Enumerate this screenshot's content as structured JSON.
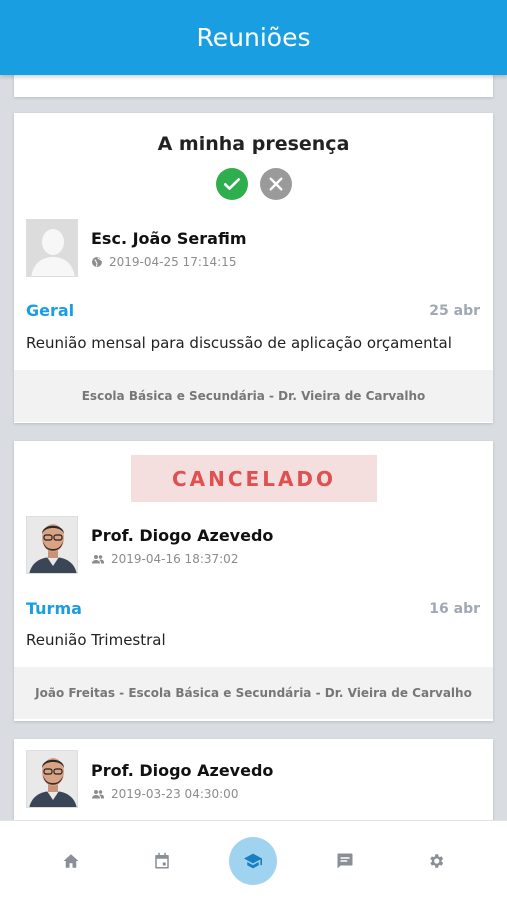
{
  "header": {
    "title": "Reuniões"
  },
  "cards": [
    {
      "presence_title": "A minha presença",
      "author": "Esc. João Serafim",
      "timestamp": "2019-04-25 17:14:15",
      "visibility_icon": "globe-icon",
      "category": "Geral",
      "date": "25 abr",
      "description": "Reunião mensal para discussão de aplicação orçamental",
      "footer": "Escola Básica e Secundária - Dr. Vieira de Carvalho"
    },
    {
      "status_badge": "CANCELADO",
      "author": "Prof. Diogo Azevedo",
      "timestamp": "2019-04-16 18:37:02",
      "visibility_icon": "group-icon",
      "category": "Turma",
      "date": "16 abr",
      "description": "Reunião Trimestral",
      "footer": "João Freitas - Escola Básica e Secundária - Dr. Vieira de Carvalho"
    },
    {
      "author": "Prof. Diogo Azevedo",
      "timestamp": "2019-03-23 04:30:00",
      "visibility_icon": "group-icon"
    }
  ],
  "tabbar": {
    "tabs": [
      {
        "icon": "home-icon",
        "active": false
      },
      {
        "icon": "calendar-icon",
        "active": false
      },
      {
        "icon": "graduation-cap-icon",
        "active": true
      },
      {
        "icon": "message-icon",
        "active": false
      },
      {
        "icon": "gear-icon",
        "active": false
      }
    ]
  },
  "colors": {
    "primary": "#1a9ee2",
    "accept": "#2fae4e",
    "decline": "#9a9a9a",
    "cancel_text": "#e05050",
    "cancel_bg": "#f4dede"
  }
}
